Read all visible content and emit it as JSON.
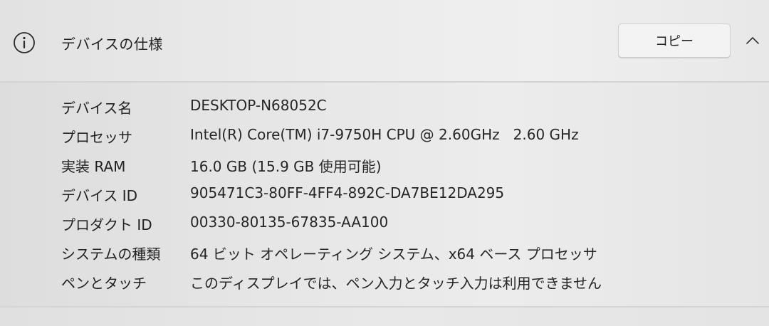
{
  "header": {
    "title": "デバイスの仕様",
    "copy_label": "コピー",
    "info_icon": "info-icon",
    "collapse_icon": "chevron-up-icon"
  },
  "specs": [
    {
      "label": "デバイス名",
      "value": "DESKTOP-N68052C"
    },
    {
      "label": "プロセッサ",
      "value": "Intel(R) Core(TM) i7-9750H CPU @ 2.60GHz   2.60 GHz"
    },
    {
      "label": "実装 RAM",
      "value": "16.0 GB (15.9 GB 使用可能)"
    },
    {
      "label": "デバイス ID",
      "value": "905471C3-80FF-4FF4-892C-DA7BE12DA295"
    },
    {
      "label": "プロダクト ID",
      "value": "00330-80135-67835-AA100"
    },
    {
      "label": "システムの種類",
      "value": "64 ビット オペレーティング システム、x64 ベース プロセッサ"
    },
    {
      "label": "ペンとタッチ",
      "value": "このディスプレイでは、ペン入力とタッチ入力は利用できません"
    }
  ]
}
